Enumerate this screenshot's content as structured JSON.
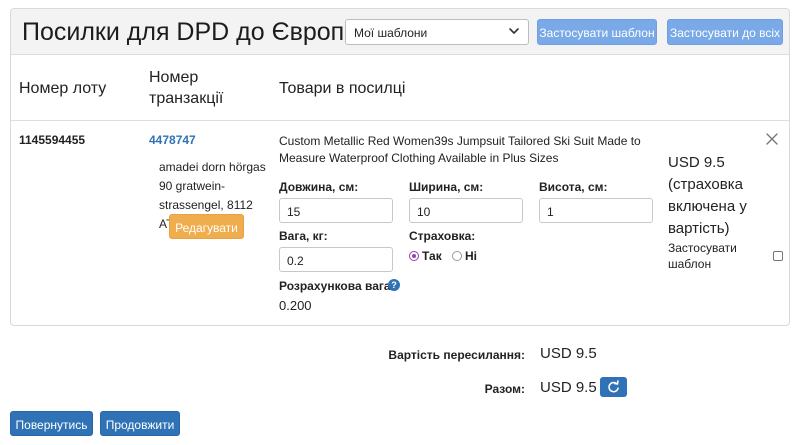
{
  "header": {
    "title": "Посилки для DPD до Європи",
    "template_select": {
      "value": "Мої шаблони"
    },
    "apply_template_label": "Застосувати шаблон",
    "apply_all_label": "Застосувати до всіх"
  },
  "columns": {
    "lot": "Номер лоту",
    "transaction_line1": "Номер",
    "transaction_line2": "транзакції",
    "goods": "Товари в посилці"
  },
  "parcel": {
    "lot_number": "1145594455",
    "transaction": "4478747",
    "address_line1": "amadei dorn hörgas",
    "address_line2": "90 gratwein-",
    "address_line3": "strassengel, 8112 AT",
    "edit_label": "Редагувати",
    "product_title": "Custom Metallic Red Women39s Jumpsuit Tailored Ski Suit Made to Measure Waterproof Clothing Available in Plus Sizes",
    "length_label": "Довжина, см:",
    "length_value": "15",
    "width_label": "Ширина, см:",
    "width_value": "10",
    "height_label": "Висота, см:",
    "height_value": "1",
    "weight_label": "Вага, кг:",
    "weight_value": "0.2",
    "insurance_label": "Страховка:",
    "insurance_yes": "Так",
    "insurance_no": "Ні",
    "insurance_selected": "yes",
    "calc_weight_label": "Розрахункова вага:",
    "calc_weight_value": "0.200",
    "price_line1": "USD 9.5",
    "price_line2": "(страховка",
    "price_line3": "включена у",
    "price_line4": "вартість)",
    "apply_template_line1": "Застосувати",
    "apply_template_line2": "шаблон",
    "apply_template_checked": false
  },
  "summary": {
    "shipping_label": "Вартість пересилання:",
    "shipping_value": "USD 9.5",
    "total_label": "Разом:",
    "total_value": "USD 9.5"
  },
  "footer": {
    "back_label": "Повернутись",
    "continue_label": "Продовжити"
  },
  "colors": {
    "primary": "#2f72b5",
    "primary_light": "#7aa9e8",
    "warning": "#f0ad4e",
    "radio_accent": "#8e44ad"
  },
  "icons": [
    "chevron-down-icon",
    "close-icon",
    "help-icon",
    "refresh-icon"
  ]
}
